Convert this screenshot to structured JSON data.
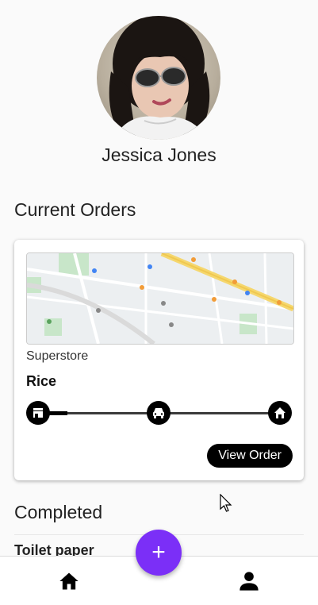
{
  "profile": {
    "name": "Jessica Jones"
  },
  "current_orders": {
    "title": "Current Orders",
    "order": {
      "store": "Superstore",
      "item": "Rice",
      "progress": 0.12,
      "stops": [
        "store-icon",
        "car-icon",
        "home-icon"
      ],
      "view_label": "View Order"
    }
  },
  "completed": {
    "title": "Completed",
    "items": [
      "Toilet paper"
    ]
  },
  "fab": {
    "label": "+"
  },
  "nav": {
    "items": [
      "home-icon",
      "person-icon"
    ]
  },
  "colors": {
    "accent": "#7b2ff7",
    "primary": "#000000"
  }
}
